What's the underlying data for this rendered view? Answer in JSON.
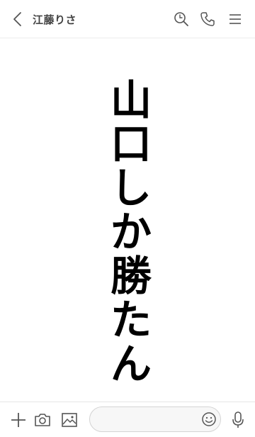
{
  "header": {
    "contact_name": "江藤りさ",
    "icons": [
      "chevron-left-icon",
      "search-icon",
      "phone-icon",
      "hamburger-menu-icon"
    ]
  },
  "message": {
    "vertical_characters": [
      "山",
      "口",
      "し",
      "か",
      "勝",
      "た",
      "ん"
    ]
  },
  "footer": {
    "input_placeholder": "",
    "icons": [
      "plus-icon",
      "camera-icon",
      "image-icon",
      "smiley-icon",
      "microphone-icon"
    ]
  },
  "colors": {
    "icon": "#555555",
    "text": "#000000",
    "header_text": "#444444"
  }
}
